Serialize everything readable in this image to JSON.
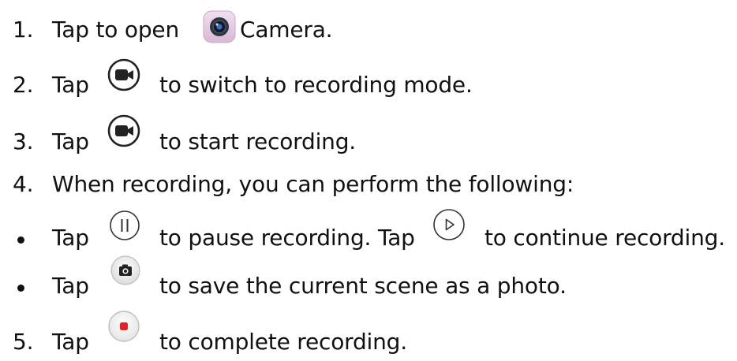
{
  "steps": [
    {
      "number": "1.",
      "text_before": "Tap to open",
      "icon": "camera-app-icon",
      "text_after": "Camera."
    },
    {
      "number": "2.",
      "text_before": "Tap",
      "icon": "video-mode-icon",
      "text_after": "to switch to recording mode."
    },
    {
      "number": "3.",
      "text_before": "Tap",
      "icon": "video-mode-icon",
      "text_after": "to start recording."
    },
    {
      "number": "4.",
      "text": "When recording, you can perform the following:"
    }
  ],
  "bullets": [
    {
      "text_before": "Tap",
      "icon": "pause-icon",
      "text_middle": "to pause recording. Tap",
      "icon2": "play-icon",
      "text_after": "to continue recording."
    },
    {
      "text_before": "Tap",
      "icon": "snapshot-camera-icon",
      "text_after": "to save the current scene as a photo."
    }
  ],
  "final_step": {
    "number": "5.",
    "text_before": "Tap",
    "icon": "stop-record-icon",
    "text_after": "to complete recording."
  },
  "colors": {
    "text": "#111111",
    "record_red": "#e02424",
    "app_icon_bg": "#e8cde4",
    "icon_stroke": "#333333"
  }
}
